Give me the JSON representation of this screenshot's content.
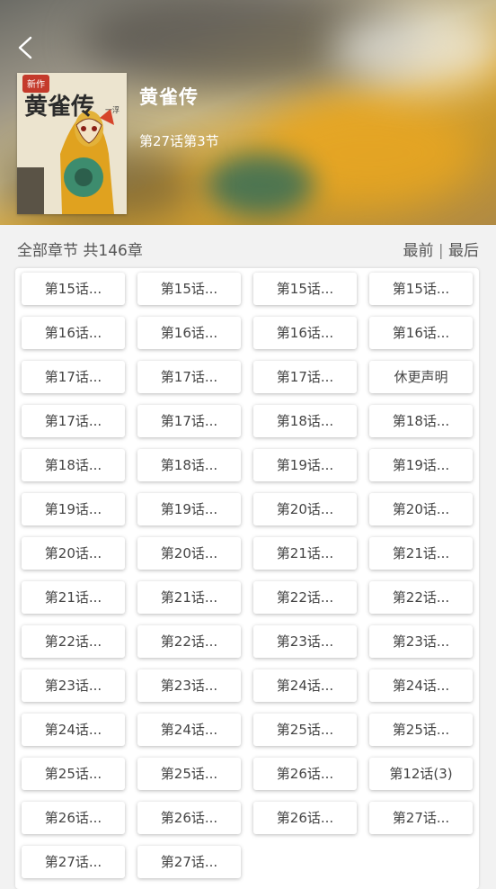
{
  "header": {
    "back_icon": "back-arrow-icon",
    "cover_icon": "comic-cover-image",
    "cover_text": "黄雀传",
    "title": "黄雀传",
    "progress": "第27话第3节"
  },
  "chapter_bar": {
    "count_label": "全部章节 共146章",
    "sort_first": "最前",
    "separator": "|",
    "sort_last": "最后"
  },
  "chapters": [
    "第15话...",
    "第15话...",
    "第15话...",
    "第15话...",
    "第16话...",
    "第16话...",
    "第16话...",
    "第16话...",
    "第17话...",
    "第17话...",
    "第17话...",
    "休更声明",
    "第17话...",
    "第17话...",
    "第18话...",
    "第18话...",
    "第18话...",
    "第18话...",
    "第19话...",
    "第19话...",
    "第19话...",
    "第19话...",
    "第20话...",
    "第20话...",
    "第20话...",
    "第20话...",
    "第21话...",
    "第21话...",
    "第21话...",
    "第21话...",
    "第22话...",
    "第22话...",
    "第22话...",
    "第22话...",
    "第23话...",
    "第23话...",
    "第23话...",
    "第23话...",
    "第24话...",
    "第24话...",
    "第24话...",
    "第24话...",
    "第25话...",
    "第25话...",
    "第25话...",
    "第25话...",
    "第26话...",
    "第12话(3)",
    "第26话...",
    "第26话...",
    "第26话...",
    "第27话...",
    "第27话...",
    "第27话..."
  ]
}
